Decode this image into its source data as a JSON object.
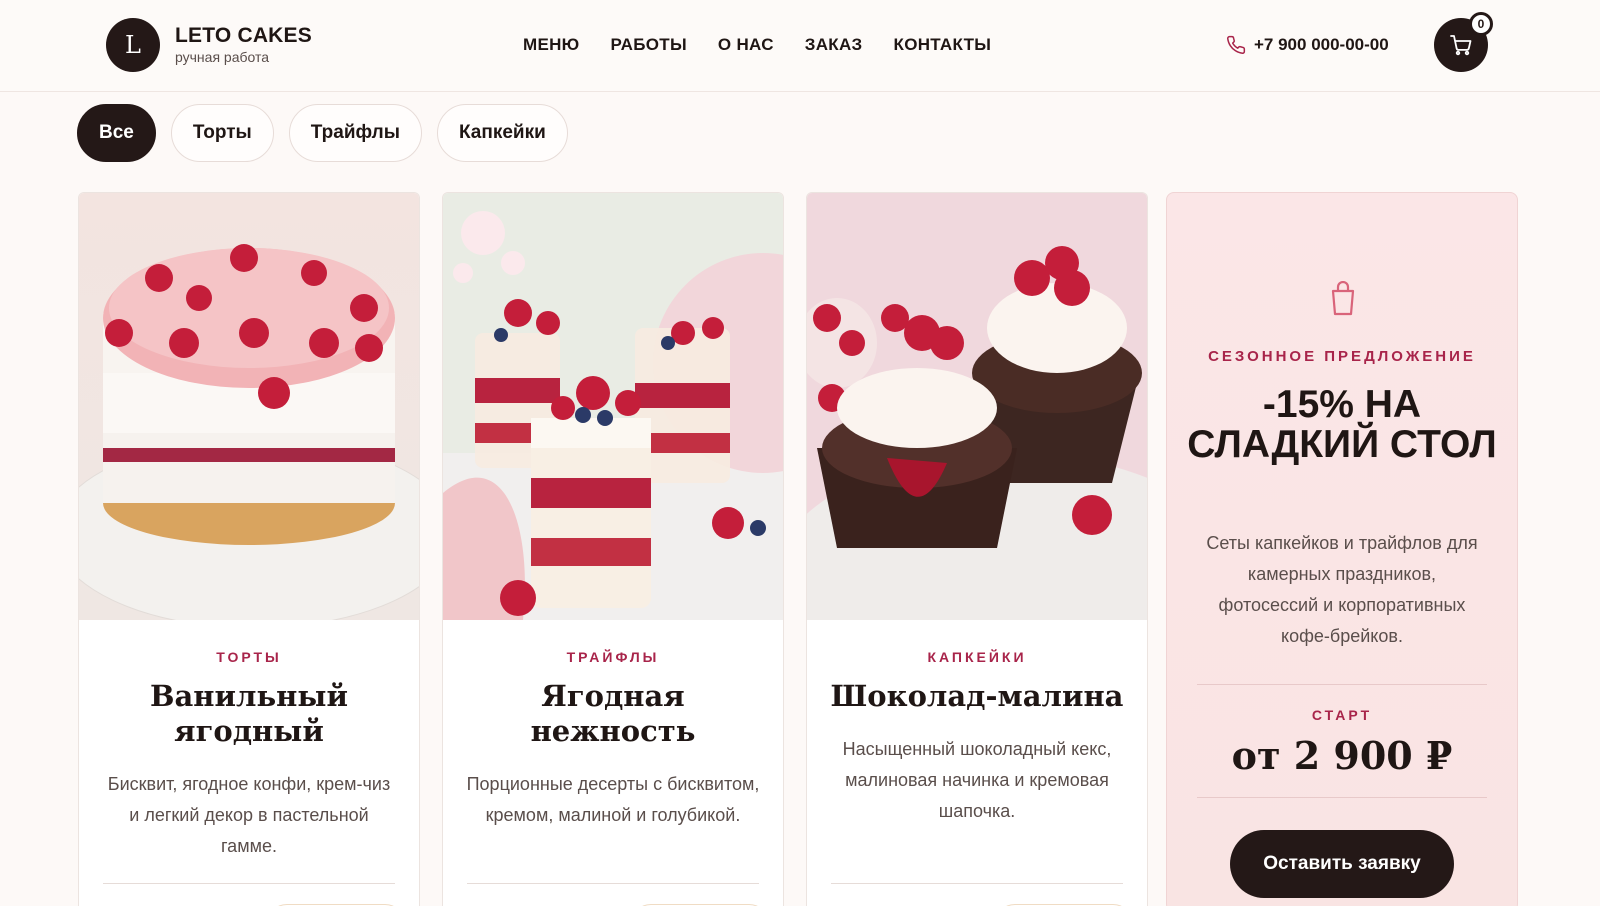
{
  "header": {
    "logo_letter": "L",
    "brand": "LETO CAKES",
    "tagline": "ручная работа",
    "nav": [
      "МЕНЮ",
      "РАБОТЫ",
      "О НАС",
      "ЗАКАЗ",
      "КОНТАКТЫ"
    ],
    "phone": "+7 900 000-00-00",
    "cart_count": "0",
    "icons": {
      "phone": "phone-icon",
      "cart": "cart-icon"
    }
  },
  "filters": [
    {
      "label": "Все",
      "active": true
    },
    {
      "label": "Торты",
      "active": false
    },
    {
      "label": "Трайфлы",
      "active": false
    },
    {
      "label": "Капкейки",
      "active": false
    }
  ],
  "cards": [
    {
      "category": "ТОРТЫ",
      "title": "Ванильный ягодный",
      "description": "Бисквит, ягодное конфи, крем-чиз и легкий декор в пастельной гамме."
    },
    {
      "category": "ТРАЙФЛЫ",
      "title": "Ягодная нежность",
      "description": "Порционные десерты с бисквитом, кремом, малиной и голубикой."
    },
    {
      "category": "КАПКЕЙКИ",
      "title": "Шоколад-малина",
      "description": "Насыщенный шоколадный кекс, малиновая начинка и кремовая шапочка."
    }
  ],
  "promo": {
    "eyebrow": "СЕЗОННОЕ ПРЕДЛОЖЕНИЕ",
    "headline": "-15% НА СЛАДКИЙ СТОЛ",
    "description": "Сеты капкейков и трайфлов для камерных праздников, фотосессий и корпоративных кофе-брейков.",
    "start_label": "СТАРТ",
    "price": "от 2 900 ₽",
    "cta": "Оставить заявку",
    "icon": "shopping-bag-icon"
  },
  "colors": {
    "dark": "#241817",
    "accent": "#a8244a",
    "background": "#fdf9f7",
    "promo_bg": "#fbe6e7"
  }
}
